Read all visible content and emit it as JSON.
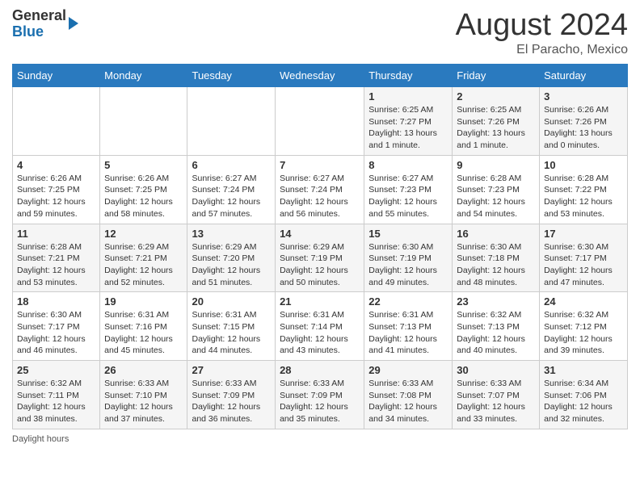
{
  "header": {
    "logo_general": "General",
    "logo_blue": "Blue",
    "month_title": "August 2024",
    "location": "El Paracho, Mexico"
  },
  "calendar": {
    "days_of_week": [
      "Sunday",
      "Monday",
      "Tuesday",
      "Wednesday",
      "Thursday",
      "Friday",
      "Saturday"
    ],
    "weeks": [
      [
        {
          "day": "",
          "sunrise": "",
          "sunset": "",
          "daylight": ""
        },
        {
          "day": "",
          "sunrise": "",
          "sunset": "",
          "daylight": ""
        },
        {
          "day": "",
          "sunrise": "",
          "sunset": "",
          "daylight": ""
        },
        {
          "day": "",
          "sunrise": "",
          "sunset": "",
          "daylight": ""
        },
        {
          "day": "1",
          "sunrise": "Sunrise: 6:25 AM",
          "sunset": "Sunset: 7:27 PM",
          "daylight": "Daylight: 13 hours and 1 minute."
        },
        {
          "day": "2",
          "sunrise": "Sunrise: 6:25 AM",
          "sunset": "Sunset: 7:26 PM",
          "daylight": "Daylight: 13 hours and 1 minute."
        },
        {
          "day": "3",
          "sunrise": "Sunrise: 6:26 AM",
          "sunset": "Sunset: 7:26 PM",
          "daylight": "Daylight: 13 hours and 0 minutes."
        }
      ],
      [
        {
          "day": "4",
          "sunrise": "Sunrise: 6:26 AM",
          "sunset": "Sunset: 7:25 PM",
          "daylight": "Daylight: 12 hours and 59 minutes."
        },
        {
          "day": "5",
          "sunrise": "Sunrise: 6:26 AM",
          "sunset": "Sunset: 7:25 PM",
          "daylight": "Daylight: 12 hours and 58 minutes."
        },
        {
          "day": "6",
          "sunrise": "Sunrise: 6:27 AM",
          "sunset": "Sunset: 7:24 PM",
          "daylight": "Daylight: 12 hours and 57 minutes."
        },
        {
          "day": "7",
          "sunrise": "Sunrise: 6:27 AM",
          "sunset": "Sunset: 7:24 PM",
          "daylight": "Daylight: 12 hours and 56 minutes."
        },
        {
          "day": "8",
          "sunrise": "Sunrise: 6:27 AM",
          "sunset": "Sunset: 7:23 PM",
          "daylight": "Daylight: 12 hours and 55 minutes."
        },
        {
          "day": "9",
          "sunrise": "Sunrise: 6:28 AM",
          "sunset": "Sunset: 7:23 PM",
          "daylight": "Daylight: 12 hours and 54 minutes."
        },
        {
          "day": "10",
          "sunrise": "Sunrise: 6:28 AM",
          "sunset": "Sunset: 7:22 PM",
          "daylight": "Daylight: 12 hours and 53 minutes."
        }
      ],
      [
        {
          "day": "11",
          "sunrise": "Sunrise: 6:28 AM",
          "sunset": "Sunset: 7:21 PM",
          "daylight": "Daylight: 12 hours and 53 minutes."
        },
        {
          "day": "12",
          "sunrise": "Sunrise: 6:29 AM",
          "sunset": "Sunset: 7:21 PM",
          "daylight": "Daylight: 12 hours and 52 minutes."
        },
        {
          "day": "13",
          "sunrise": "Sunrise: 6:29 AM",
          "sunset": "Sunset: 7:20 PM",
          "daylight": "Daylight: 12 hours and 51 minutes."
        },
        {
          "day": "14",
          "sunrise": "Sunrise: 6:29 AM",
          "sunset": "Sunset: 7:19 PM",
          "daylight": "Daylight: 12 hours and 50 minutes."
        },
        {
          "day": "15",
          "sunrise": "Sunrise: 6:30 AM",
          "sunset": "Sunset: 7:19 PM",
          "daylight": "Daylight: 12 hours and 49 minutes."
        },
        {
          "day": "16",
          "sunrise": "Sunrise: 6:30 AM",
          "sunset": "Sunset: 7:18 PM",
          "daylight": "Daylight: 12 hours and 48 minutes."
        },
        {
          "day": "17",
          "sunrise": "Sunrise: 6:30 AM",
          "sunset": "Sunset: 7:17 PM",
          "daylight": "Daylight: 12 hours and 47 minutes."
        }
      ],
      [
        {
          "day": "18",
          "sunrise": "Sunrise: 6:30 AM",
          "sunset": "Sunset: 7:17 PM",
          "daylight": "Daylight: 12 hours and 46 minutes."
        },
        {
          "day": "19",
          "sunrise": "Sunrise: 6:31 AM",
          "sunset": "Sunset: 7:16 PM",
          "daylight": "Daylight: 12 hours and 45 minutes."
        },
        {
          "day": "20",
          "sunrise": "Sunrise: 6:31 AM",
          "sunset": "Sunset: 7:15 PM",
          "daylight": "Daylight: 12 hours and 44 minutes."
        },
        {
          "day": "21",
          "sunrise": "Sunrise: 6:31 AM",
          "sunset": "Sunset: 7:14 PM",
          "daylight": "Daylight: 12 hours and 43 minutes."
        },
        {
          "day": "22",
          "sunrise": "Sunrise: 6:31 AM",
          "sunset": "Sunset: 7:13 PM",
          "daylight": "Daylight: 12 hours and 41 minutes."
        },
        {
          "day": "23",
          "sunrise": "Sunrise: 6:32 AM",
          "sunset": "Sunset: 7:13 PM",
          "daylight": "Daylight: 12 hours and 40 minutes."
        },
        {
          "day": "24",
          "sunrise": "Sunrise: 6:32 AM",
          "sunset": "Sunset: 7:12 PM",
          "daylight": "Daylight: 12 hours and 39 minutes."
        }
      ],
      [
        {
          "day": "25",
          "sunrise": "Sunrise: 6:32 AM",
          "sunset": "Sunset: 7:11 PM",
          "daylight": "Daylight: 12 hours and 38 minutes."
        },
        {
          "day": "26",
          "sunrise": "Sunrise: 6:33 AM",
          "sunset": "Sunset: 7:10 PM",
          "daylight": "Daylight: 12 hours and 37 minutes."
        },
        {
          "day": "27",
          "sunrise": "Sunrise: 6:33 AM",
          "sunset": "Sunset: 7:09 PM",
          "daylight": "Daylight: 12 hours and 36 minutes."
        },
        {
          "day": "28",
          "sunrise": "Sunrise: 6:33 AM",
          "sunset": "Sunset: 7:09 PM",
          "daylight": "Daylight: 12 hours and 35 minutes."
        },
        {
          "day": "29",
          "sunrise": "Sunrise: 6:33 AM",
          "sunset": "Sunset: 7:08 PM",
          "daylight": "Daylight: 12 hours and 34 minutes."
        },
        {
          "day": "30",
          "sunrise": "Sunrise: 6:33 AM",
          "sunset": "Sunset: 7:07 PM",
          "daylight": "Daylight: 12 hours and 33 minutes."
        },
        {
          "day": "31",
          "sunrise": "Sunrise: 6:34 AM",
          "sunset": "Sunset: 7:06 PM",
          "daylight": "Daylight: 12 hours and 32 minutes."
        }
      ]
    ]
  },
  "footer": {
    "daylight_label": "Daylight hours"
  }
}
